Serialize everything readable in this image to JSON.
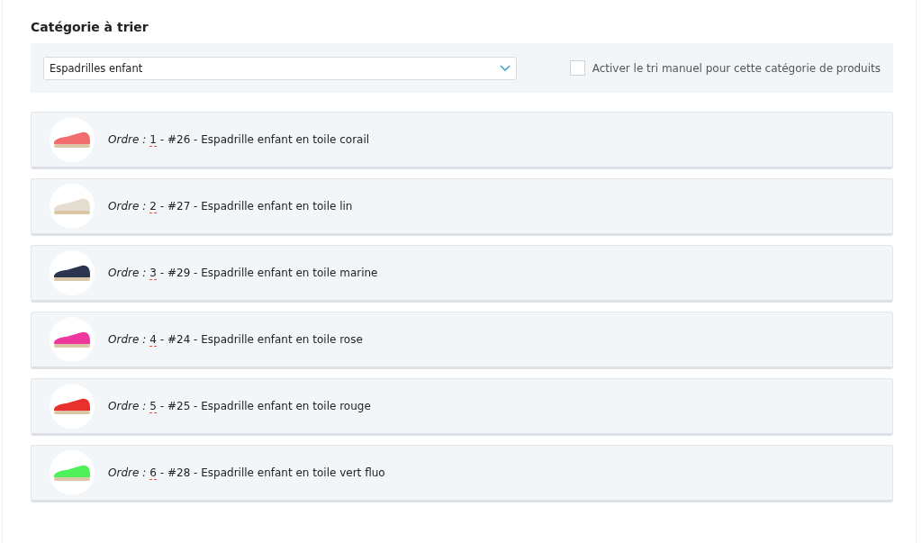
{
  "heading": "Catégorie à trier",
  "category_select": {
    "value": "Espadrilles enfant"
  },
  "manual_sort": {
    "label": "Activer le tri manuel pour cette catégorie de produits",
    "checked": false
  },
  "products": [
    {
      "order_label": "Ordre :",
      "order": "1",
      "title": "- #26 - Espadrille enfant en toile corail",
      "color": "#f26d6d"
    },
    {
      "order_label": "Ordre :",
      "order": "2",
      "title": "- #27 - Espadrille enfant en toile lin",
      "color": "#e4ddd0"
    },
    {
      "order_label": "Ordre :",
      "order": "3",
      "title": "- #29 - Espadrille enfant en toile marine",
      "color": "#2c3550"
    },
    {
      "order_label": "Ordre :",
      "order": "4",
      "title": "- #24 - Espadrille enfant en toile rose",
      "color": "#f0369f"
    },
    {
      "order_label": "Ordre :",
      "order": "5",
      "title": "- #25 - Espadrille enfant en toile rouge",
      "color": "#e8302c"
    },
    {
      "order_label": "Ordre :",
      "order": "6",
      "title": "- #28 - Espadrille enfant en toile vert fluo",
      "color": "#4ff05a"
    }
  ]
}
